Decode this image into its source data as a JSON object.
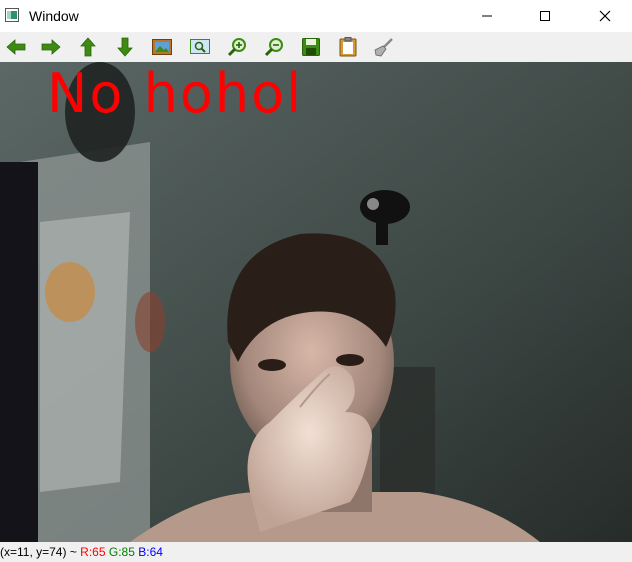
{
  "window": {
    "title": "Window"
  },
  "title_controls": [
    {
      "name": "minimize-button",
      "icon": "minimize-icon"
    },
    {
      "name": "maximize-button",
      "icon": "maximize-icon"
    },
    {
      "name": "close-button",
      "icon": "close-icon"
    }
  ],
  "toolbar": {
    "buttons": [
      {
        "name": "pan-left-button",
        "icon": "arrow-left-icon"
      },
      {
        "name": "pan-right-button",
        "icon": "arrow-right-icon"
      },
      {
        "name": "pan-up-button",
        "icon": "arrow-up-icon"
      },
      {
        "name": "pan-down-button",
        "icon": "arrow-down-icon"
      },
      {
        "name": "zoom-original-button",
        "icon": "image-icon"
      },
      {
        "name": "zoom-fit-button",
        "icon": "zoom-window-icon"
      },
      {
        "name": "zoom-in-button",
        "icon": "zoom-in-icon"
      },
      {
        "name": "zoom-out-button",
        "icon": "zoom-out-icon"
      },
      {
        "name": "save-button",
        "icon": "save-icon"
      },
      {
        "name": "properties-button",
        "icon": "clipboard-icon"
      },
      {
        "name": "clear-button",
        "icon": "brush-icon"
      }
    ]
  },
  "image": {
    "overlay_text": "No hohol"
  },
  "status": {
    "coords": "(x=11, y=74) ~",
    "r": "R:65",
    "g": "G:85",
    "b": "B:64"
  },
  "colors": {
    "overlay": "#ff0000",
    "toolbar_green": "#3d8b12",
    "status_r": "#ff0000",
    "status_g": "#008000",
    "status_b": "#0000ff"
  }
}
